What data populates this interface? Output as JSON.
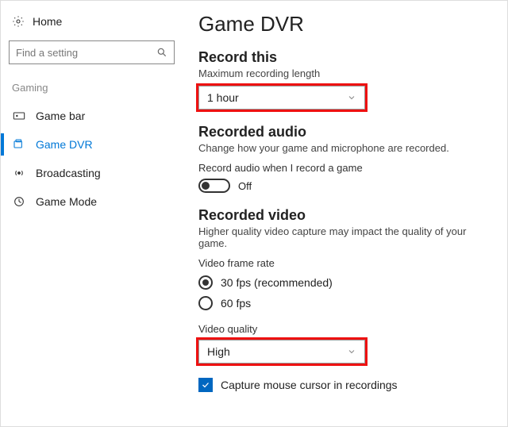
{
  "sidebar": {
    "home_label": "Home",
    "search_placeholder": "Find a setting",
    "section_label": "Gaming",
    "items": [
      {
        "label": "Game bar"
      },
      {
        "label": "Game DVR"
      },
      {
        "label": "Broadcasting"
      },
      {
        "label": "Game Mode"
      }
    ]
  },
  "main": {
    "title": "Game DVR",
    "record_this": {
      "heading": "Record this",
      "sub": "Maximum recording length",
      "value": "1 hour"
    },
    "recorded_audio": {
      "heading": "Recorded audio",
      "sub": "Change how your game and microphone are recorded.",
      "toggle_label": "Record audio when I record a game",
      "toggle_state": "Off"
    },
    "recorded_video": {
      "heading": "Recorded video",
      "sub": "Higher quality video capture may impact the quality of your game.",
      "frame_rate_label": "Video frame rate",
      "options": [
        {
          "label": "30 fps (recommended)",
          "selected": true
        },
        {
          "label": "60 fps",
          "selected": false
        }
      ],
      "quality_label": "Video quality",
      "quality_value": "High"
    },
    "capture_cursor": {
      "label": "Capture mouse cursor in recordings",
      "checked": true
    }
  }
}
